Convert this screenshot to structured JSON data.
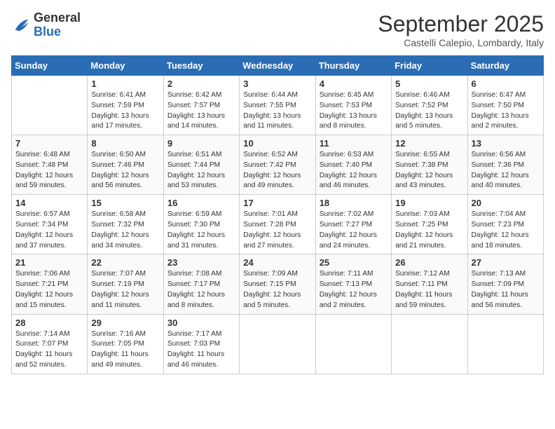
{
  "header": {
    "logo_general": "General",
    "logo_blue": "Blue",
    "month_title": "September 2025",
    "location": "Castelli Calepio, Lombardy, Italy"
  },
  "weekdays": [
    "Sunday",
    "Monday",
    "Tuesday",
    "Wednesday",
    "Thursday",
    "Friday",
    "Saturday"
  ],
  "weeks": [
    [
      {
        "day": "",
        "sunrise": "",
        "sunset": "",
        "daylight": ""
      },
      {
        "day": "1",
        "sunrise": "Sunrise: 6:41 AM",
        "sunset": "Sunset: 7:59 PM",
        "daylight": "Daylight: 13 hours and 17 minutes."
      },
      {
        "day": "2",
        "sunrise": "Sunrise: 6:42 AM",
        "sunset": "Sunset: 7:57 PM",
        "daylight": "Daylight: 13 hours and 14 minutes."
      },
      {
        "day": "3",
        "sunrise": "Sunrise: 6:44 AM",
        "sunset": "Sunset: 7:55 PM",
        "daylight": "Daylight: 13 hours and 11 minutes."
      },
      {
        "day": "4",
        "sunrise": "Sunrise: 6:45 AM",
        "sunset": "Sunset: 7:53 PM",
        "daylight": "Daylight: 13 hours and 8 minutes."
      },
      {
        "day": "5",
        "sunrise": "Sunrise: 6:46 AM",
        "sunset": "Sunset: 7:52 PM",
        "daylight": "Daylight: 13 hours and 5 minutes."
      },
      {
        "day": "6",
        "sunrise": "Sunrise: 6:47 AM",
        "sunset": "Sunset: 7:50 PM",
        "daylight": "Daylight: 13 hours and 2 minutes."
      }
    ],
    [
      {
        "day": "7",
        "sunrise": "Sunrise: 6:48 AM",
        "sunset": "Sunset: 7:48 PM",
        "daylight": "Daylight: 12 hours and 59 minutes."
      },
      {
        "day": "8",
        "sunrise": "Sunrise: 6:50 AM",
        "sunset": "Sunset: 7:46 PM",
        "daylight": "Daylight: 12 hours and 56 minutes."
      },
      {
        "day": "9",
        "sunrise": "Sunrise: 6:51 AM",
        "sunset": "Sunset: 7:44 PM",
        "daylight": "Daylight: 12 hours and 53 minutes."
      },
      {
        "day": "10",
        "sunrise": "Sunrise: 6:52 AM",
        "sunset": "Sunset: 7:42 PM",
        "daylight": "Daylight: 12 hours and 49 minutes."
      },
      {
        "day": "11",
        "sunrise": "Sunrise: 6:53 AM",
        "sunset": "Sunset: 7:40 PM",
        "daylight": "Daylight: 12 hours and 46 minutes."
      },
      {
        "day": "12",
        "sunrise": "Sunrise: 6:55 AM",
        "sunset": "Sunset: 7:38 PM",
        "daylight": "Daylight: 12 hours and 43 minutes."
      },
      {
        "day": "13",
        "sunrise": "Sunrise: 6:56 AM",
        "sunset": "Sunset: 7:36 PM",
        "daylight": "Daylight: 12 hours and 40 minutes."
      }
    ],
    [
      {
        "day": "14",
        "sunrise": "Sunrise: 6:57 AM",
        "sunset": "Sunset: 7:34 PM",
        "daylight": "Daylight: 12 hours and 37 minutes."
      },
      {
        "day": "15",
        "sunrise": "Sunrise: 6:58 AM",
        "sunset": "Sunset: 7:32 PM",
        "daylight": "Daylight: 12 hours and 34 minutes."
      },
      {
        "day": "16",
        "sunrise": "Sunrise: 6:59 AM",
        "sunset": "Sunset: 7:30 PM",
        "daylight": "Daylight: 12 hours and 31 minutes."
      },
      {
        "day": "17",
        "sunrise": "Sunrise: 7:01 AM",
        "sunset": "Sunset: 7:28 PM",
        "daylight": "Daylight: 12 hours and 27 minutes."
      },
      {
        "day": "18",
        "sunrise": "Sunrise: 7:02 AM",
        "sunset": "Sunset: 7:27 PM",
        "daylight": "Daylight: 12 hours and 24 minutes."
      },
      {
        "day": "19",
        "sunrise": "Sunrise: 7:03 AM",
        "sunset": "Sunset: 7:25 PM",
        "daylight": "Daylight: 12 hours and 21 minutes."
      },
      {
        "day": "20",
        "sunrise": "Sunrise: 7:04 AM",
        "sunset": "Sunset: 7:23 PM",
        "daylight": "Daylight: 12 hours and 18 minutes."
      }
    ],
    [
      {
        "day": "21",
        "sunrise": "Sunrise: 7:06 AM",
        "sunset": "Sunset: 7:21 PM",
        "daylight": "Daylight: 12 hours and 15 minutes."
      },
      {
        "day": "22",
        "sunrise": "Sunrise: 7:07 AM",
        "sunset": "Sunset: 7:19 PM",
        "daylight": "Daylight: 12 hours and 11 minutes."
      },
      {
        "day": "23",
        "sunrise": "Sunrise: 7:08 AM",
        "sunset": "Sunset: 7:17 PM",
        "daylight": "Daylight: 12 hours and 8 minutes."
      },
      {
        "day": "24",
        "sunrise": "Sunrise: 7:09 AM",
        "sunset": "Sunset: 7:15 PM",
        "daylight": "Daylight: 12 hours and 5 minutes."
      },
      {
        "day": "25",
        "sunrise": "Sunrise: 7:11 AM",
        "sunset": "Sunset: 7:13 PM",
        "daylight": "Daylight: 12 hours and 2 minutes."
      },
      {
        "day": "26",
        "sunrise": "Sunrise: 7:12 AM",
        "sunset": "Sunset: 7:11 PM",
        "daylight": "Daylight: 11 hours and 59 minutes."
      },
      {
        "day": "27",
        "sunrise": "Sunrise: 7:13 AM",
        "sunset": "Sunset: 7:09 PM",
        "daylight": "Daylight: 11 hours and 56 minutes."
      }
    ],
    [
      {
        "day": "28",
        "sunrise": "Sunrise: 7:14 AM",
        "sunset": "Sunset: 7:07 PM",
        "daylight": "Daylight: 11 hours and 52 minutes."
      },
      {
        "day": "29",
        "sunrise": "Sunrise: 7:16 AM",
        "sunset": "Sunset: 7:05 PM",
        "daylight": "Daylight: 11 hours and 49 minutes."
      },
      {
        "day": "30",
        "sunrise": "Sunrise: 7:17 AM",
        "sunset": "Sunset: 7:03 PM",
        "daylight": "Daylight: 11 hours and 46 minutes."
      },
      {
        "day": "",
        "sunrise": "",
        "sunset": "",
        "daylight": ""
      },
      {
        "day": "",
        "sunrise": "",
        "sunset": "",
        "daylight": ""
      },
      {
        "day": "",
        "sunrise": "",
        "sunset": "",
        "daylight": ""
      },
      {
        "day": "",
        "sunrise": "",
        "sunset": "",
        "daylight": ""
      }
    ]
  ]
}
